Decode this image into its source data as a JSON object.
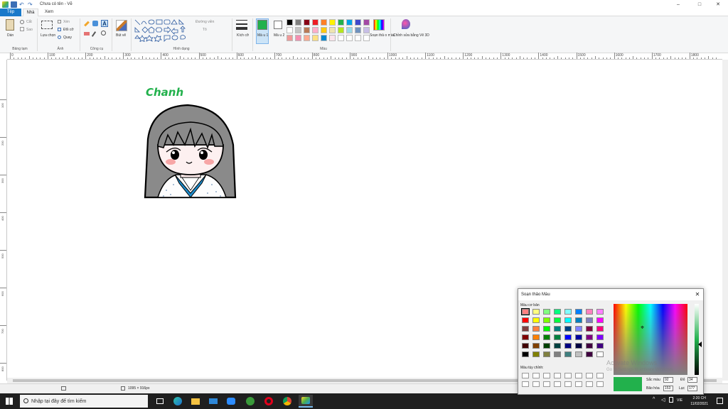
{
  "titlebar": {
    "title": "Chưa có tên - Vẽ",
    "minimize": "–",
    "maximize": "□",
    "close": "✕"
  },
  "tabs": {
    "file": "Tệp",
    "home": "Nhà",
    "view": "Xem"
  },
  "ribbon": {
    "clipboard": {
      "paste": "Dán",
      "cut": "Cắt",
      "copy": "Sao",
      "label": "Bảng tạm"
    },
    "image": {
      "select": "Lựa chọn",
      "crop": "Xén",
      "resize": "Đổi cỡ",
      "rotate": "Quay",
      "label": "Ảnh"
    },
    "tools": {
      "label": "Công cụ"
    },
    "brushes": {
      "label": "Bút vẽ"
    },
    "shapes": {
      "outline": "Đường viền",
      "fill": "Tô",
      "label": "Hình dạng"
    },
    "size": {
      "label": "Kích cỡ"
    },
    "color1": {
      "label": "Mà u 1"
    },
    "color2": {
      "label": "Mà u 2"
    },
    "colors": {
      "label": "Màu"
    },
    "edit_colors": {
      "label": "Soạn thả o màu"
    },
    "paint3d": {
      "label": "Chỉnh sửa bằng Vẽ 3D"
    }
  },
  "ruler": {
    "marks": [
      "0",
      "100",
      "200",
      "300",
      "400",
      "500",
      "600",
      "700",
      "800",
      "900",
      "1000",
      "1100",
      "1200",
      "1300",
      "1400",
      "1500",
      "1600",
      "1700",
      "1800"
    ]
  },
  "vruler": {
    "marks": [
      "100",
      "200",
      "300",
      "400",
      "500",
      "600",
      "700",
      "800"
    ]
  },
  "canvas": {
    "text": "Chanh"
  },
  "statusbar": {
    "dimensions": "1095 × 916px"
  },
  "taskbar": {
    "search_placeholder": "Nhập tại đây để tìm kiếm",
    "lang": "VIE",
    "time": "2:20 CH",
    "date": "11/02/2021"
  },
  "dialog": {
    "title": "Soạn thảo Màu",
    "basic_colors": "Màu cơ bản",
    "custom_colors": "Màu tùy chỉnh:",
    "hue_label": "Sắc màu",
    "hue": "92",
    "sat_label": "Bão hòa",
    "sat": "153",
    "red_label": "Đỏ",
    "red": "34",
    "green_label": "Lục",
    "green": "177",
    "watermark_title": "Activate Windows",
    "watermark_sub": "Go to Settings to activate Windows."
  },
  "colors": {
    "accent": "#1979ca",
    "color1": "#22b14c",
    "palette": [
      "#000000",
      "#7f7f7f",
      "#880015",
      "#ed1c24",
      "#ff7f27",
      "#fff200",
      "#22b14c",
      "#00a2e8",
      "#3f48cc",
      "#a349a4",
      "#ffffff",
      "#c3c3c3",
      "#b97a57",
      "#ffaec9",
      "#ffc90e",
      "#efe4b0",
      "#b5e61d",
      "#99d9ea",
      "#7092be",
      "#c8bfe7",
      "#ef9a9a",
      "#f48fb1",
      "#ffab91",
      "#ffe082",
      "#0288d1",
      "#fce4ec",
      "#ffffff",
      "#ffffff",
      "#ffffff",
      "#ffffff"
    ],
    "basic": [
      "#ff8080",
      "#ffff80",
      "#80ff80",
      "#00ff80",
      "#80ffff",
      "#0080ff",
      "#ff80c0",
      "#ff80ff",
      "#ff0000",
      "#ffff00",
      "#80ff00",
      "#00ff40",
      "#00ffff",
      "#0080c0",
      "#8080c0",
      "#ff00ff",
      "#804040",
      "#ff8040",
      "#00ff00",
      "#008080",
      "#004080",
      "#8080ff",
      "#800040",
      "#ff0080",
      "#800000",
      "#ff8000",
      "#008000",
      "#008040",
      "#0000ff",
      "#0000a0",
      "#800080",
      "#8000ff",
      "#400000",
      "#804000",
      "#004000",
      "#004040",
      "#000080",
      "#000040",
      "#400040",
      "#400080",
      "#000000",
      "#808000",
      "#808040",
      "#808080",
      "#408080",
      "#c0c0c0",
      "#400040",
      "#ffffff"
    ]
  }
}
